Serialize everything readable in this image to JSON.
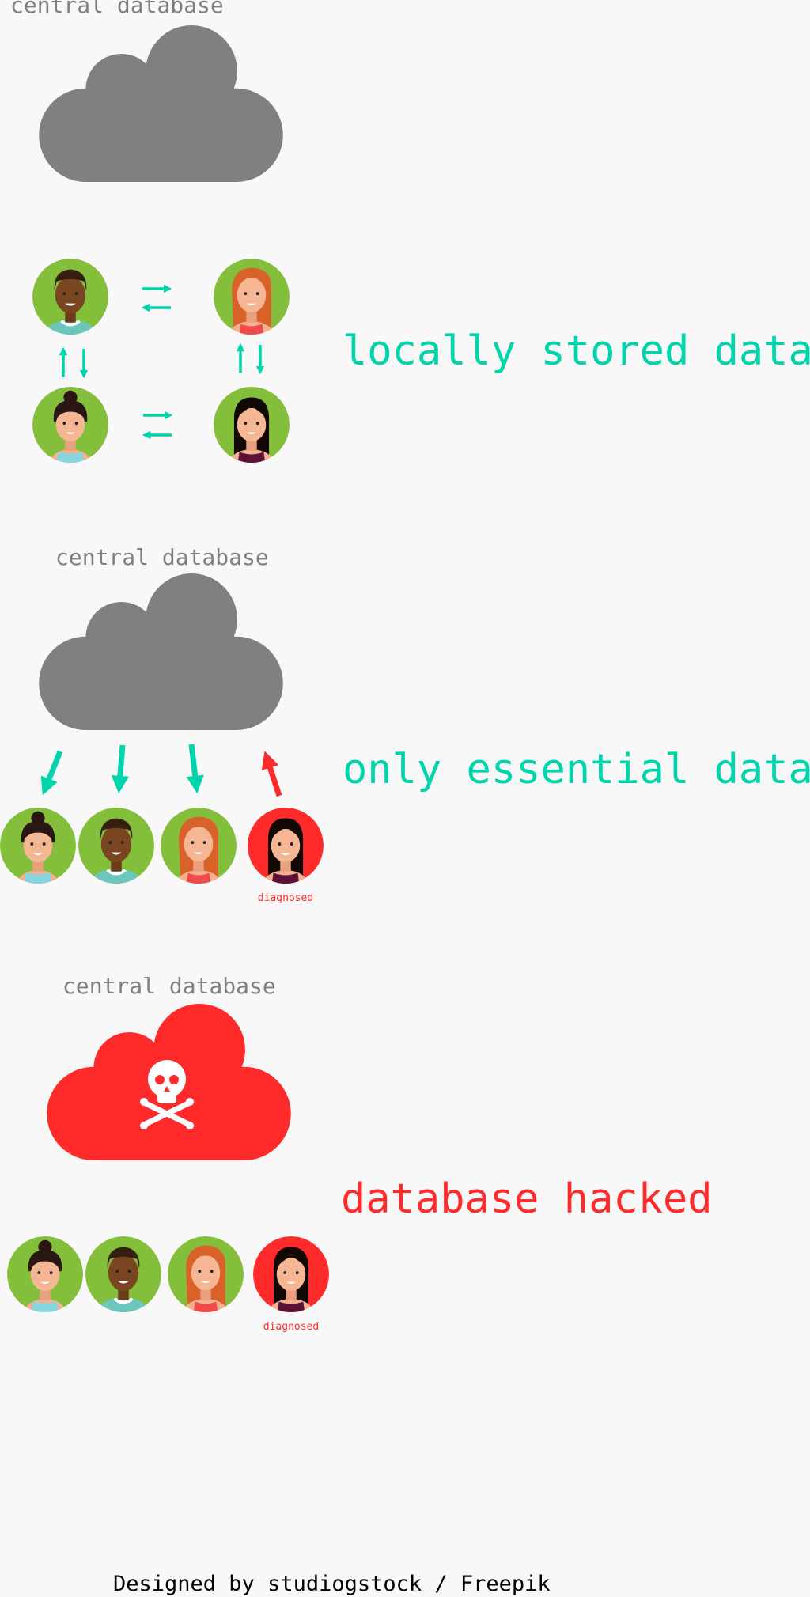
{
  "colors": {
    "teal": "#00d4aa",
    "red": "#ff2b2b",
    "cloud_gray": "#808080",
    "avatar_green": "#84bf3c",
    "background": "#f8f8f8"
  },
  "section1": {
    "cloud_label": "central database",
    "caption": "locally stored data"
  },
  "section2": {
    "cloud_label": "central database",
    "caption": "only essential data",
    "diagnosed_label": "diagnosed"
  },
  "section3": {
    "cloud_label": "central database",
    "caption": "database hacked",
    "diagnosed_label": "diagnosed",
    "cloud_icon": "skull-crossbones-icon"
  },
  "footer": "Designed by studiogstock / Freepik"
}
